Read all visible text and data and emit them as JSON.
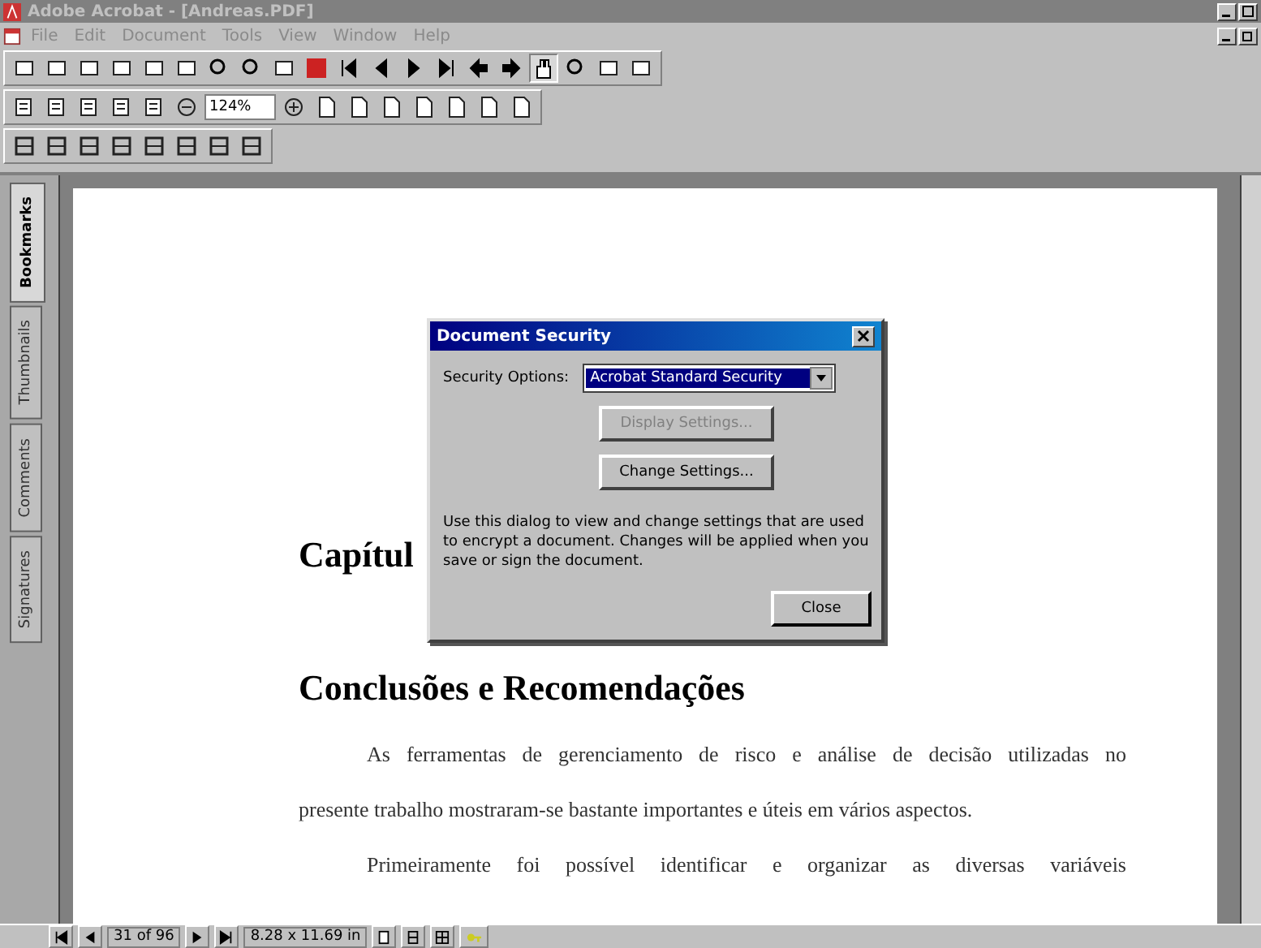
{
  "window": {
    "title": "Adobe Acrobat - [Andreas.PDF]"
  },
  "menu": [
    "File",
    "Edit",
    "Document",
    "Tools",
    "View",
    "Window",
    "Help"
  ],
  "zoom": {
    "value": "124%"
  },
  "side_tabs": [
    {
      "label": "Bookmarks",
      "selected": true
    },
    {
      "label": "Thumbnails",
      "selected": false
    },
    {
      "label": "Comments",
      "selected": false
    },
    {
      "label": "Signatures",
      "selected": false
    }
  ],
  "document": {
    "heading_1": "Capítul",
    "heading_2": "Conclusões e Recomendações",
    "lines": [
      "As ferramentas de gerenciamento de risco e análise de decisão utilizadas no",
      "presente trabalho mostraram-se bastante importantes e úteis em vários aspectos.",
      "Primeiramente foi possível identificar e organizar as diversas variáveis"
    ]
  },
  "dialog": {
    "title": "Document Security",
    "option_label": "Security Options:",
    "option_value": "Acrobat Standard Security",
    "buttons": [
      {
        "label": "Display Settings...",
        "disabled": true
      },
      {
        "label": "Change Settings...",
        "disabled": false
      }
    ],
    "description": "Use this dialog to view and change settings that are used to encrypt a document. Changes will be applied when you save or sign the document.",
    "close": "Close"
  },
  "status_bar": {
    "page": "31 of 96",
    "size": "8.28 x 11.69 in"
  }
}
